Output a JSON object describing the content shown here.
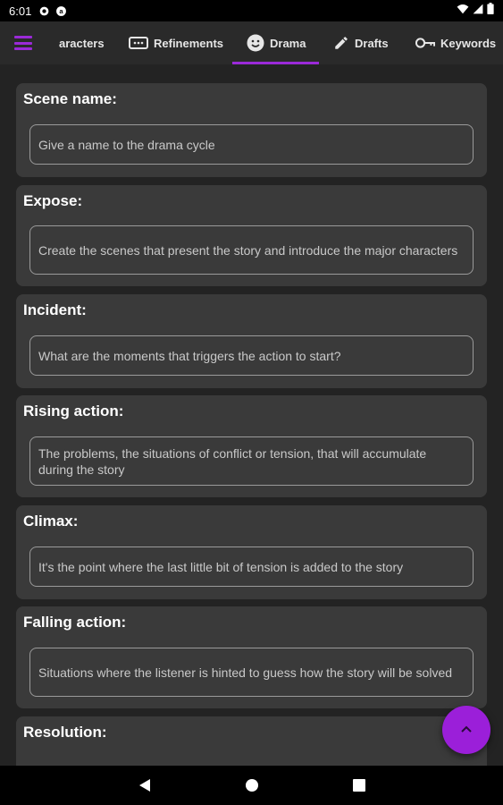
{
  "status_bar": {
    "time": "6:01",
    "icons": [
      "gear-icon",
      "at-sign-icon",
      "wifi-icon",
      "signal-icon",
      "battery-icon"
    ]
  },
  "tabs": [
    {
      "label": "aracters",
      "icon": "people-icon",
      "selected": false
    },
    {
      "label": "Refinements",
      "icon": "dots-box-icon",
      "selected": false
    },
    {
      "label": "Drama",
      "icon": "face-icon",
      "selected": true
    },
    {
      "label": "Drafts",
      "icon": "pencil-icon",
      "selected": false
    },
    {
      "label": "Keywords",
      "icon": "key-icon",
      "selected": false
    }
  ],
  "sections": [
    {
      "title": "Scene name:",
      "placeholder": "Give a name to the drama cycle"
    },
    {
      "title": "Expose:",
      "placeholder": "Create the scenes that present the story and introduce the major characters"
    },
    {
      "title": "Incident:",
      "placeholder": "What are the moments that triggers the action to start?"
    },
    {
      "title": "Rising action:",
      "placeholder": "The problems, the situations of conflict or tension, that will accumulate during the story"
    },
    {
      "title": "Climax:",
      "placeholder": "It's the point where the last little bit of tension is added to the story"
    },
    {
      "title": "Falling action:",
      "placeholder": "Situations where the listener is hinted to guess how the story will be solved"
    },
    {
      "title": "Resolution:",
      "placeholder": ""
    }
  ],
  "fab": {
    "icon": "chevron-up-icon"
  },
  "colors": {
    "accent": "#9b2ad8",
    "card": "#3a3a3a",
    "background": "#232323"
  }
}
